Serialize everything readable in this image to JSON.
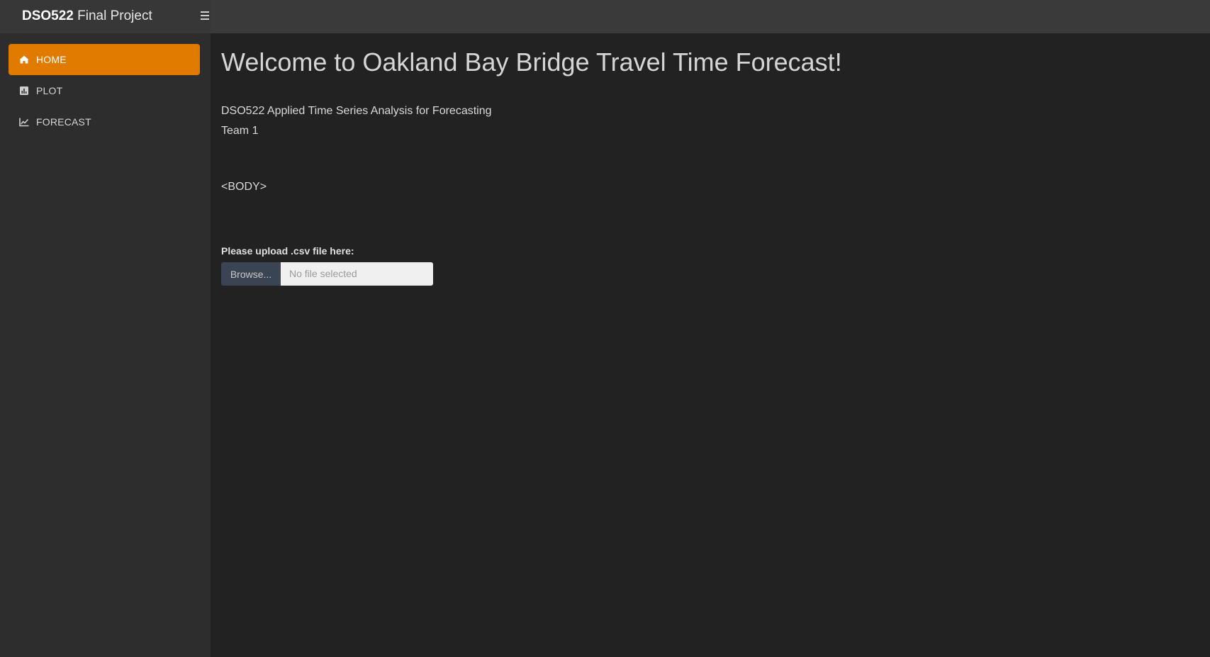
{
  "header": {
    "brand_bold": "DSO522",
    "brand_light": "Final Project",
    "menu_toggle_icon": "hamburger-menu-icon"
  },
  "sidebar": {
    "active_color": "#e07b00",
    "items": [
      {
        "label": "HOME",
        "icon": "home-icon",
        "active": true
      },
      {
        "label": "PLOT",
        "icon": "bar-chart-icon",
        "active": false
      },
      {
        "label": "FORECAST",
        "icon": "line-chart-icon",
        "active": false
      }
    ]
  },
  "main": {
    "title": "Welcome to Oakland Bay Bridge Travel Time Forecast!",
    "subtitle": "DSO522 Applied Time Series Analysis for Forecasting",
    "team": "Team 1",
    "body_placeholder": "<BODY>",
    "upload": {
      "label": "Please upload .csv file here:",
      "browse_label": "Browse...",
      "file_status": "No file selected"
    }
  }
}
